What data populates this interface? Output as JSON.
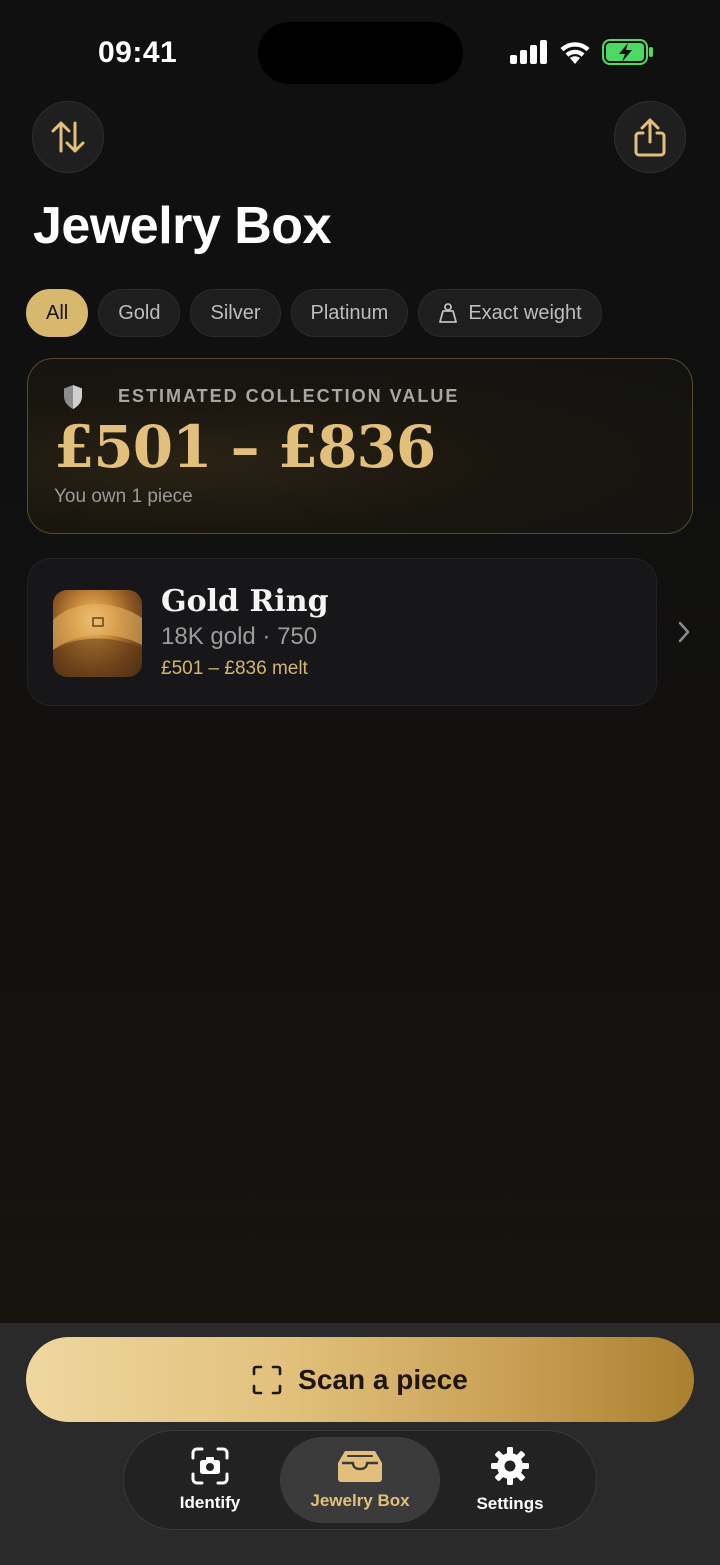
{
  "status_bar": {
    "time": "09:41"
  },
  "page_title": "Jewelry Box",
  "filters": [
    {
      "label": "All",
      "active": true
    },
    {
      "label": "Gold",
      "active": false
    },
    {
      "label": "Silver",
      "active": false
    },
    {
      "label": "Platinum",
      "active": false
    },
    {
      "label": "Exact weight",
      "active": false,
      "icon": "weight-icon"
    }
  ],
  "collection": {
    "label": "ESTIMATED COLLECTION VALUE",
    "value": "£501 – £836",
    "count_text": "You own 1 piece"
  },
  "items": [
    {
      "name": "Gold Ring",
      "detail": "18K gold · 750",
      "price": "£501 – £836 melt"
    }
  ],
  "scan_button": {
    "label": "Scan a piece"
  },
  "tabs": [
    {
      "label": "Identify",
      "icon": "camera-scan-icon"
    },
    {
      "label": "Jewelry Box",
      "icon": "tray-icon",
      "active": true
    },
    {
      "label": "Settings",
      "icon": "gear-icon"
    }
  ],
  "colors": {
    "accent": "#e2c07b",
    "background": "#121212"
  }
}
